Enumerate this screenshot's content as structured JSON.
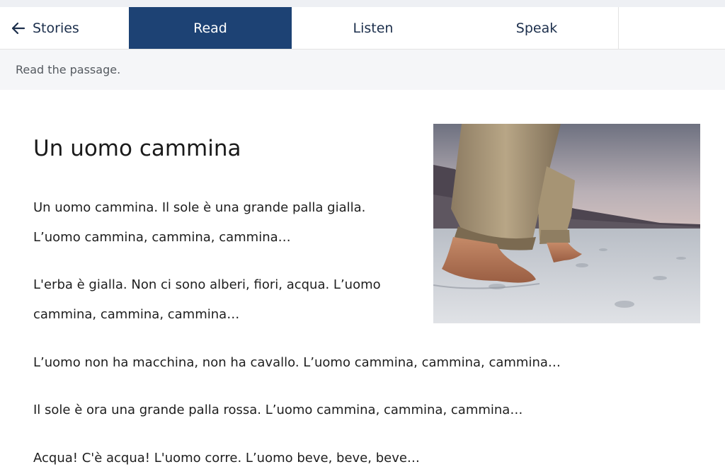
{
  "nav": {
    "back_label": "Stories",
    "tabs": [
      {
        "label": "Read",
        "active": true
      },
      {
        "label": "Listen",
        "active": false
      },
      {
        "label": "Speak",
        "active": false
      }
    ]
  },
  "instruction": "Read the passage.",
  "story": {
    "title": "Un uomo cammina",
    "paragraphs": [
      {
        "lines": [
          "Un uomo cammina. Il sole è una grande palla gialla.",
          "L’uomo cammina, cammina, cammina…"
        ]
      },
      {
        "lines": [
          "L'erba è gialla. Non ci sono alberi, fiori, acqua. L’uomo",
          "cammina, cammina, cammina…"
        ]
      },
      {
        "lines": [
          "L’uomo non ha macchina, non ha cavallo. L’uomo cammina, cammina, cammina…"
        ]
      },
      {
        "lines": [
          "Il sole è ora una grande palla rossa. L’uomo cammina, cammina, cammina…"
        ]
      },
      {
        "lines": [
          "Acqua! C'è acqua! L'uomo corre. L’uomo beve, beve, beve…"
        ]
      }
    ]
  },
  "colors": {
    "active_tab": "#1d4274",
    "tab_text": "#1c2f4c",
    "subbar_bg": "#f5f6f8"
  },
  "icons": {
    "back": "arrow-left-icon"
  }
}
